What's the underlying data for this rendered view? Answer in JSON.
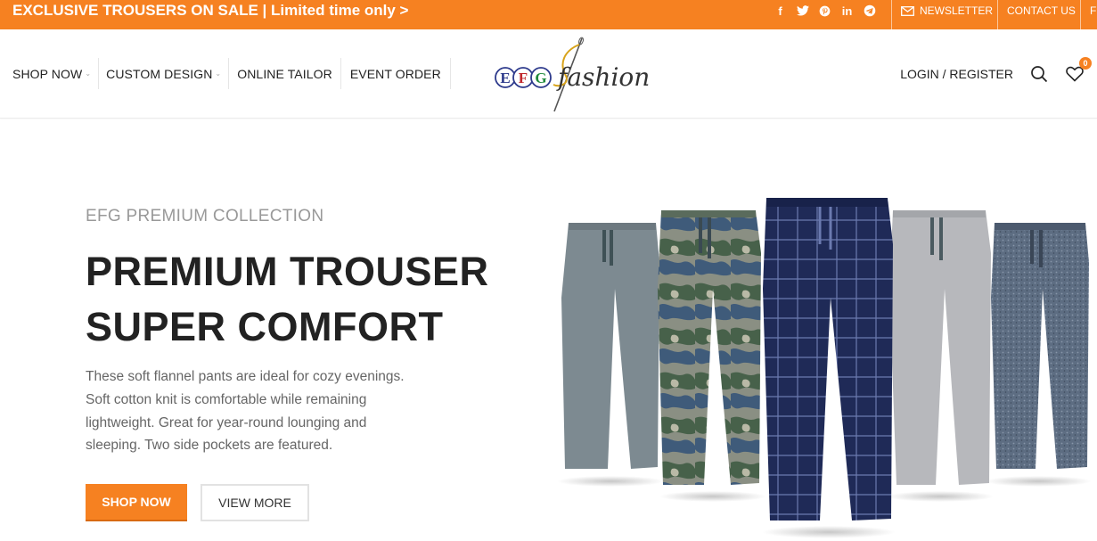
{
  "topbar": {
    "promo": "EXCLUSIVE TROUSERS ON SALE | Limited time only >",
    "social_icons": [
      "facebook-icon",
      "twitter-icon",
      "pinterest-icon",
      "linkedin-icon",
      "telegram-icon"
    ],
    "newsletter": "NEWSLETTER",
    "contact": "CONTACT US",
    "cut_off_link": "F"
  },
  "nav": {
    "items": [
      {
        "label": "SHOP NOW"
      },
      {
        "label": "CUSTOM DESIGN"
      },
      {
        "label": "ONLINE TAILOR"
      },
      {
        "label": "EVENT ORDER"
      }
    ]
  },
  "logo": {
    "letters": [
      "E",
      "F",
      "G"
    ],
    "word": "fashion"
  },
  "header_right": {
    "login": "LOGIN / REGISTER",
    "wishlist_count": "0"
  },
  "hero": {
    "eyebrow": "EFG PREMIUM COLLECTION",
    "headline_line1": "PREMIUM TROUSER",
    "headline_line2": "SUPER COMFORT",
    "description": "These soft flannel pants are ideal for cozy evenings. Soft cotton knit is comfortable while remaining lightweight. Great for year-round lounging and sleeping. Two side pockets are featured.",
    "primary_button": "SHOP NOW",
    "secondary_button": "VIEW MORE"
  },
  "colors": {
    "accent": "#f68121",
    "heading": "#222222",
    "muted": "#999999"
  }
}
